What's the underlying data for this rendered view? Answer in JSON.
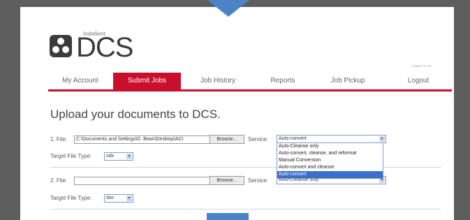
{
  "logo": {
    "brand": "Indellient",
    "name": "DCS"
  },
  "login_status": "Logged in as: ...",
  "nav": {
    "tabs": [
      {
        "label": "My Account"
      },
      {
        "label": "Submit Jobs"
      },
      {
        "label": "Job History"
      },
      {
        "label": "Reports"
      },
      {
        "label": "Job Pickup"
      },
      {
        "label": "Logout"
      }
    ],
    "active_index": 1
  },
  "main": {
    "title": "Upload your documents to DCS.",
    "rows": [
      {
        "file_label": "1. File:",
        "file_value": "C:\\Documents and Settings\\D. Bean\\Desktop\\ACI",
        "browse_label": "Browse...",
        "service_label": "Service:",
        "service_value": "Auto-convert",
        "target_label": "Target File Type:",
        "target_value": "odx"
      },
      {
        "file_label": "2. File:",
        "file_value": "",
        "browse_label": "Browse...",
        "service_label": "Service:",
        "service_value": "Auto-Cleanse only",
        "target_label": "Target File Type:",
        "target_value": "doc"
      }
    ],
    "service_options": [
      "Auto-Cleanse only",
      "Auto-convert, cleanse, and reformat",
      "Manual Conversion",
      "Auto-convert and cleanse",
      "Auto-convert"
    ],
    "service_dropdown_selected": 4
  },
  "colors": {
    "accent": "#c8102e",
    "frame": "#5e5e5e",
    "pointer": "#4b84c6",
    "selection": "#3a6fcc"
  }
}
